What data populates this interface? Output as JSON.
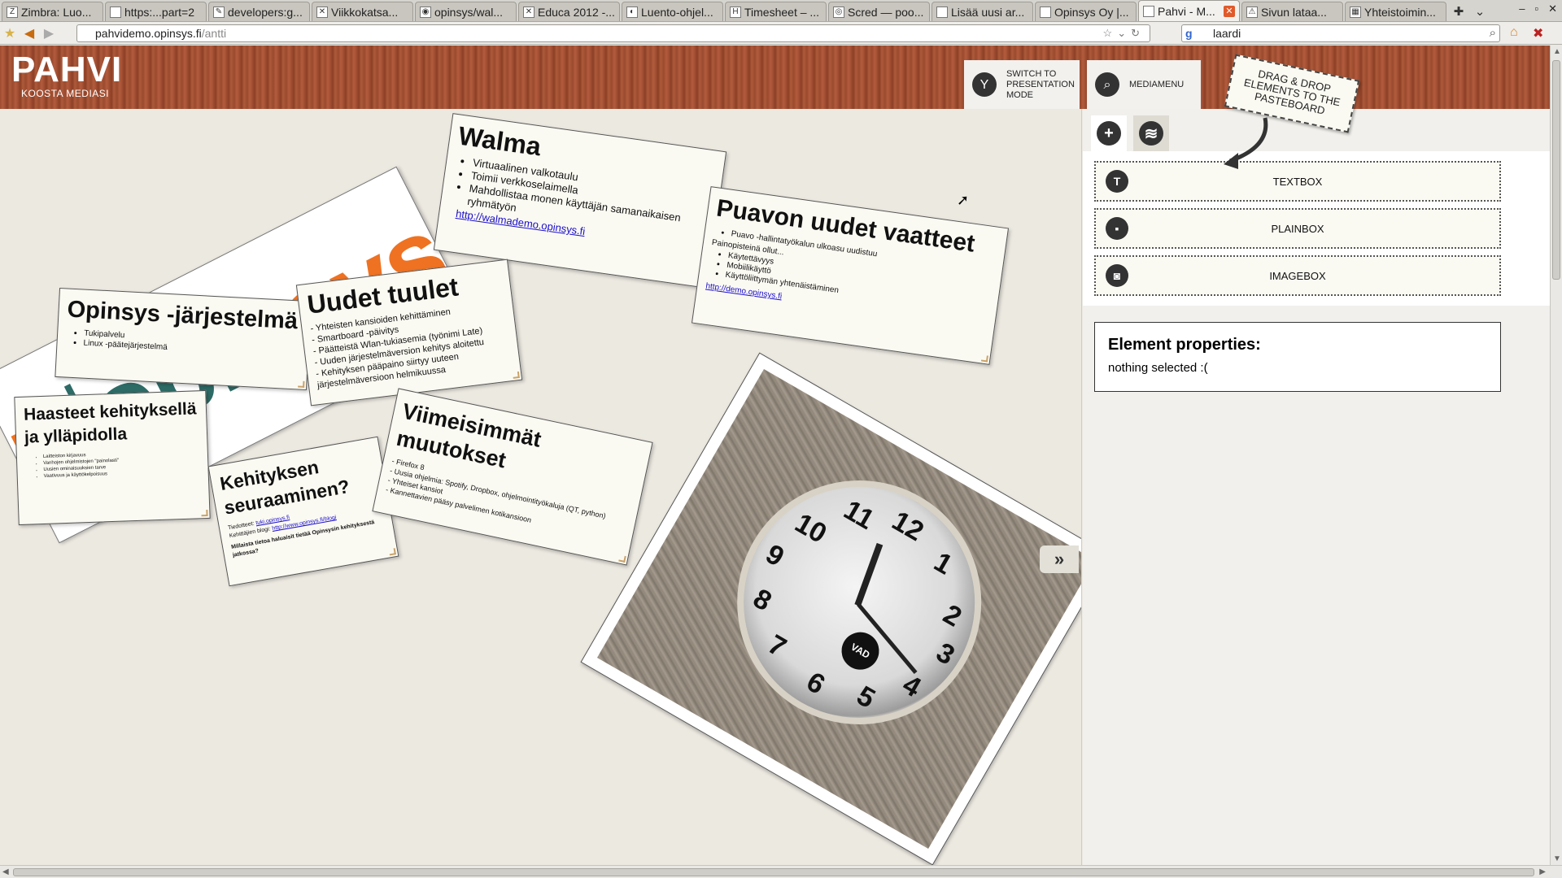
{
  "browser": {
    "tabs": [
      {
        "icon": "Z",
        "title": "Zimbra: Luo..."
      },
      {
        "icon": "",
        "title": "https:...part=2"
      },
      {
        "icon": "✎",
        "title": "developers:g..."
      },
      {
        "icon": "✕",
        "title": "Viikkokatsa..."
      },
      {
        "icon": "◉",
        "title": "opinsys/wal..."
      },
      {
        "icon": "✕",
        "title": "Educa 2012 -..."
      },
      {
        "icon": "◐",
        "title": "Luento-ohjel..."
      },
      {
        "icon": "H",
        "title": "Timesheet – ..."
      },
      {
        "icon": "◎",
        "title": "Scred — poo..."
      },
      {
        "icon": "",
        "title": "Lisää uusi ar..."
      },
      {
        "icon": "",
        "title": "Opinsys Oy |..."
      },
      {
        "icon": "",
        "title": "Pahvi - M...",
        "active": true
      },
      {
        "icon": "⚠",
        "title": "Sivun lataa..."
      },
      {
        "icon": "▦",
        "title": "Yhteistoimin..."
      }
    ],
    "url_host": "pahvidemo.opinsys.fi",
    "url_path": "/antti",
    "search_value": "laardi",
    "search_engine": "g"
  },
  "app": {
    "logo_title": "PAHVI",
    "logo_subtitle": "KOOSTA MEDIASI",
    "present_button": "SWITCH TO PRESENTATION MODE",
    "mediamenu_button": "MEDIAMENU"
  },
  "cards": {
    "walma": {
      "title": "Walma",
      "items": [
        "Virtuaalinen valkotaulu",
        "Toimii verkkoselaimella",
        "Mahdollistaa monen käyttäjän samanaikaisen ryhmätyön"
      ],
      "link": "http://walmademo.opinsys.fi"
    },
    "puavo": {
      "title": "Puavon uudet vaatteet",
      "items": [
        "Puavo -hallintatyökalun ulkoasu uudistuu"
      ],
      "subhead": "Painopisteinä ollut...",
      "subitems": [
        "Käytettävyys",
        "Mobiilikäyttö",
        "Käyttöliittymän yhtenäistäminen"
      ],
      "link": "http://demo.opinsys.fi"
    },
    "jarjestelma": {
      "title": "Opinsys -järjestelmä",
      "items": [
        "Tukipalvelu",
        "Linux -päätejärjestelmä"
      ]
    },
    "tuulet": {
      "title": "Uudet tuulet",
      "lines": [
        "- Yhteisten kansioiden kehittäminen",
        "- Smartboard -päivitys",
        "- Päätteistä Wlan-tukiasemia (työnimi Late)",
        "- Uuden järjestelmäversion kehitys aloitettu",
        "- Kehityksen pääpaino siirtyy uuteen järjestelmäversioon helmikuussa"
      ]
    },
    "haasteet": {
      "title": "Haasteet kehityksellä ja ylläpidolla",
      "items": [
        "Laitteiston kirjavuus",
        "Vanhojen ohjelmistojen \"painolasti\"",
        "Uusien ominaisuuksien tarve",
        "Vaativuus ja käyttökelpoisuus"
      ]
    },
    "seuraaminen": {
      "title": "Kehityksen seuraaminen?",
      "line1_label": "Tiedotteet:",
      "line1_link": "tuki.opinsys.fi",
      "line2_label": "Kehittäjien blogi:",
      "line2_link": "http://www.opinsys.fi/blogi",
      "question": "Millaista tietoa haluaisit tietää Opinsysin kehityksestä jatkossa?"
    },
    "viimeisimmat": {
      "title": "Viimeisimmät muutokset",
      "lines": [
        "- Firefox 8",
        "- Uusia ohjelmia: Spotify, Dropbox, ohjelmointityökaluja (QT, python)",
        "- Yhteiset kansiot",
        "- Kannettavien pääsy palvelimen kotikansioon"
      ]
    }
  },
  "logo_card": {
    "wordmark_part1": "opin",
    "wordmark_part2": "sys"
  },
  "clock": {
    "numbers": [
      "12",
      "1",
      "2",
      "3",
      "4",
      "5",
      "6",
      "7",
      "8",
      "9",
      "10",
      "11"
    ],
    "seal_text": "VAD"
  },
  "mediamenu": {
    "dnd_note": "DRAG & DROP ELEMENTS TO THE PASTEBOARD",
    "elements": [
      {
        "icon": "T",
        "label": "TEXTBOX"
      },
      {
        "icon": "▪",
        "label": "PLAINBOX"
      },
      {
        "icon": "◙",
        "label": "IMAGEBOX"
      }
    ],
    "props_title": "Element properties:",
    "props_status": "nothing selected :("
  },
  "colors": {
    "accent_orange": "#ee7222",
    "opinsys_teal": "#2d6b66",
    "header_wood": "#9d4a2f"
  }
}
